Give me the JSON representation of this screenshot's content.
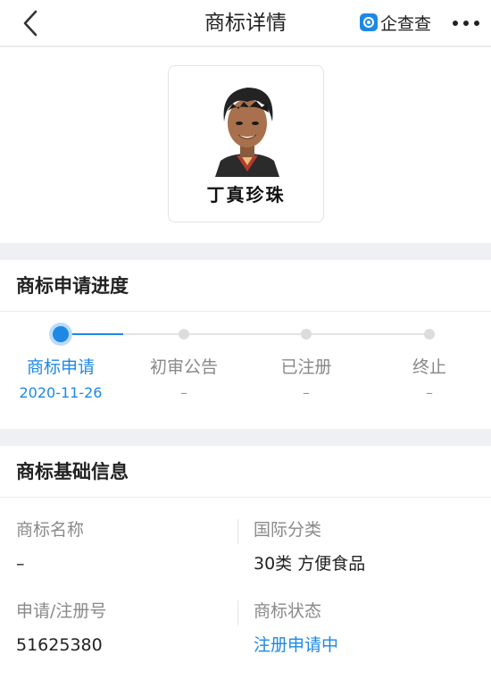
{
  "nav": {
    "title": "商标详情",
    "brand": "企查查",
    "accent": "#1e88e5"
  },
  "trademark": {
    "mark_text": "丁真珍珠"
  },
  "progress": {
    "title": "商标申请进度",
    "steps": [
      {
        "label": "商标申请",
        "date": "2020-11-26",
        "active": true
      },
      {
        "label": "初审公告",
        "date": "–",
        "active": false
      },
      {
        "label": "已注册",
        "date": "–",
        "active": false
      },
      {
        "label": "终止",
        "date": "–",
        "active": false
      }
    ]
  },
  "basic": {
    "title": "商标基础信息",
    "fields": {
      "name_label": "商标名称",
      "name_value": "–",
      "class_label": "国际分类",
      "class_value": "30类 方便食品",
      "regno_label": "申请/注册号",
      "regno_value": "51625380",
      "status_label": "商标状态",
      "status_value": "注册申请中"
    }
  },
  "icons": [
    "back-arrow-icon",
    "qichacha-logo-icon",
    "more-icon"
  ]
}
